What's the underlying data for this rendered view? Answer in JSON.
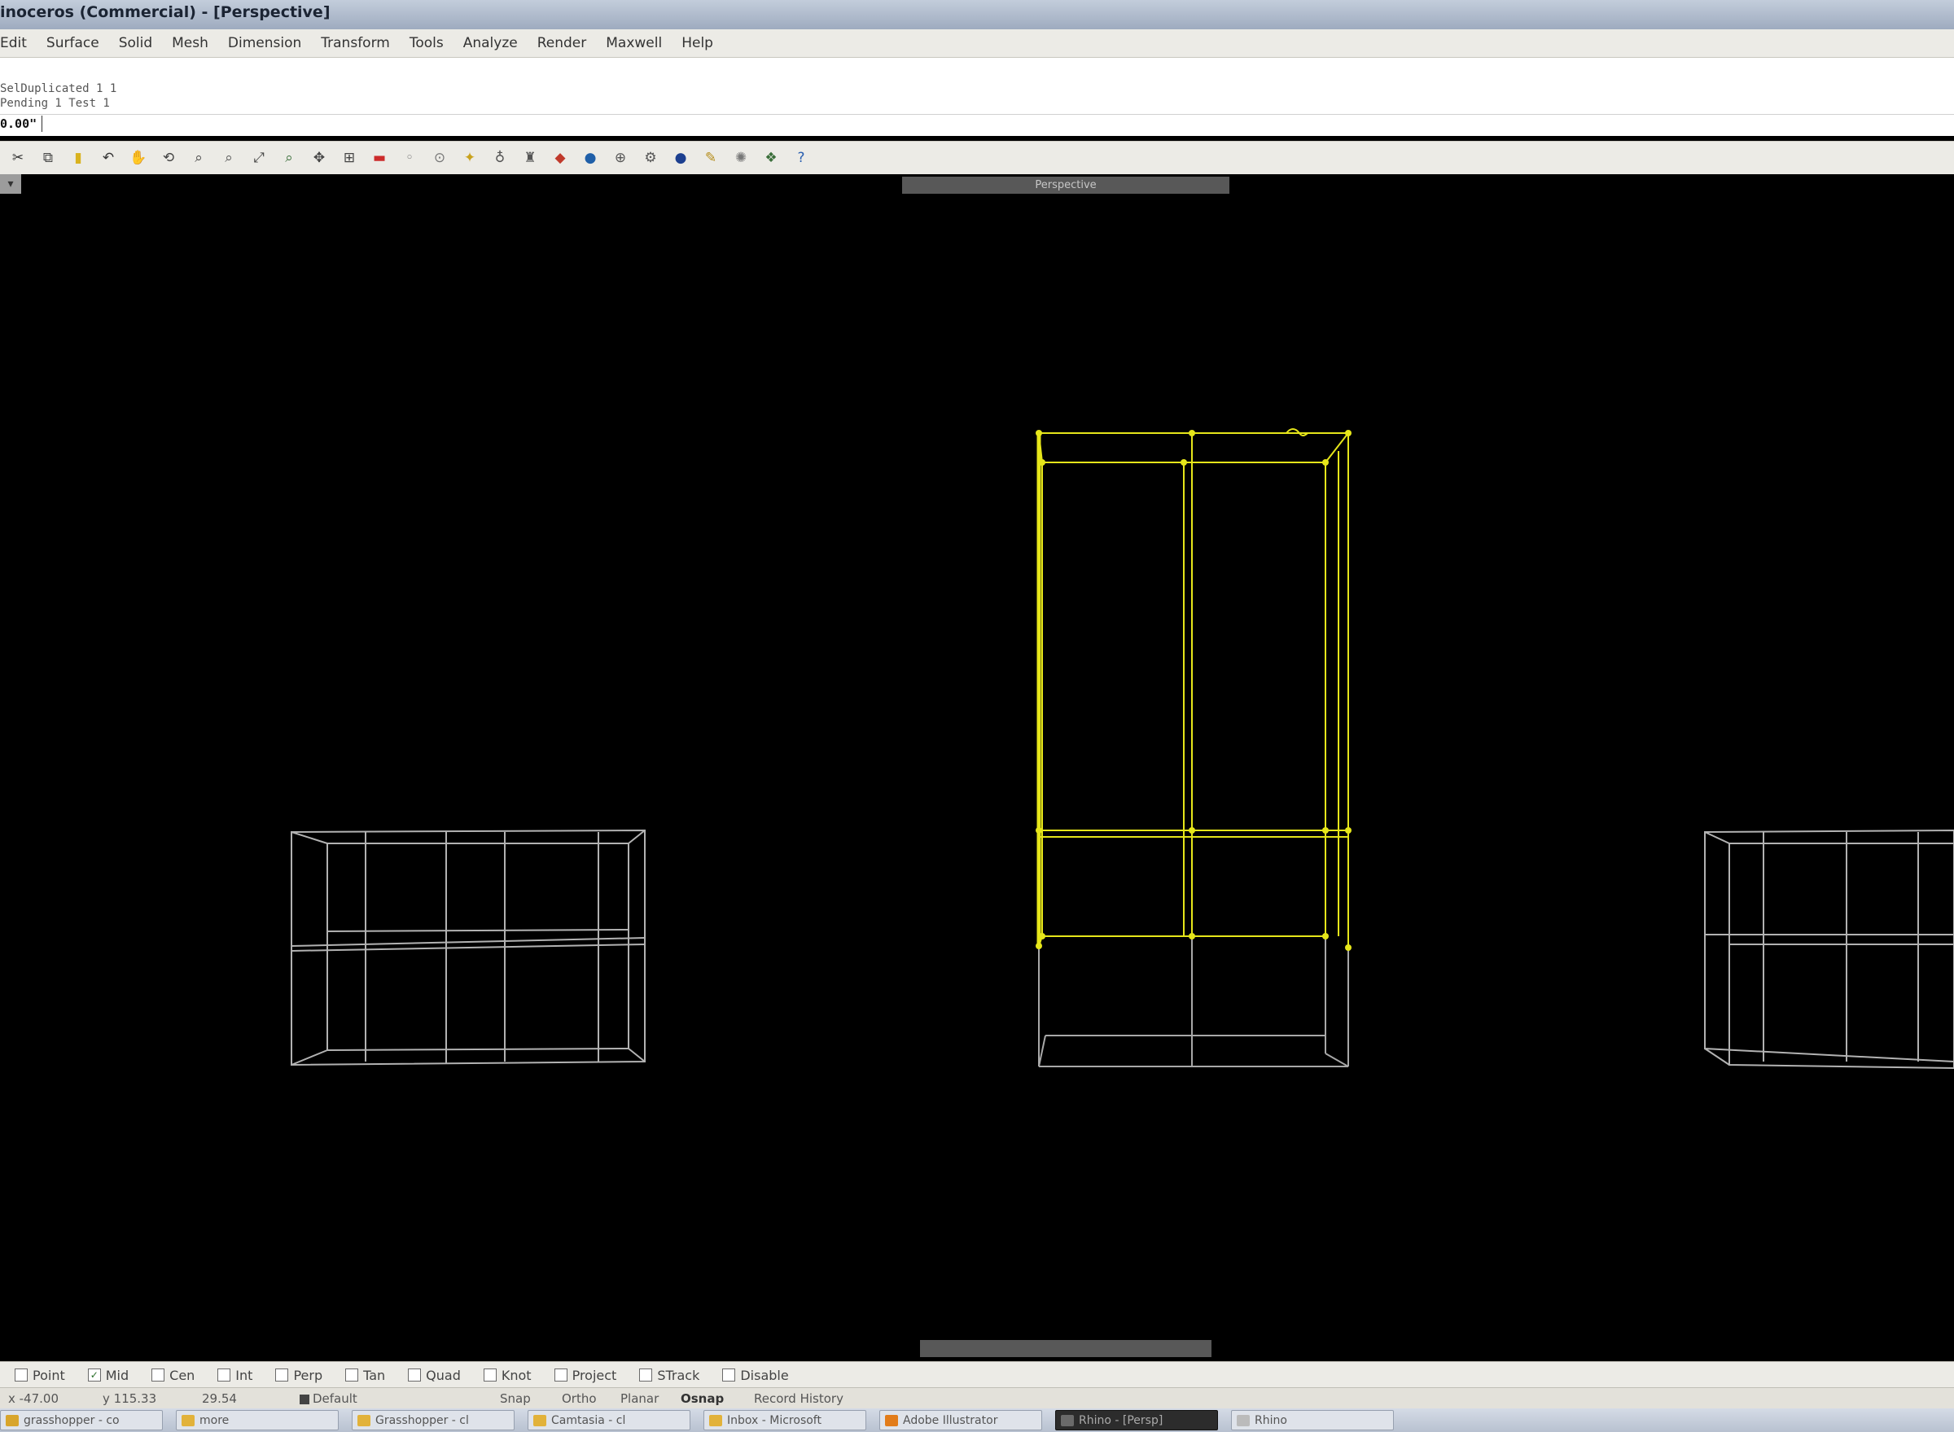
{
  "window": {
    "title": "inoceros (Commercial) - [Perspective]"
  },
  "menu": [
    "Edit",
    "Surface",
    "Solid",
    "Mesh",
    "Dimension",
    "Transform",
    "Tools",
    "Analyze",
    "Render",
    "Maxwell",
    "Help"
  ],
  "command": {
    "history": [
      "SelDuplicated 1 1",
      "Pending 1 Test 1"
    ],
    "prompt": "0.00\"",
    "input_value": ""
  },
  "toolbar": {
    "icons": [
      {
        "name": "cut-icon",
        "glyph": "✂",
        "color": "#333333"
      },
      {
        "name": "copy-icon",
        "glyph": "⧉",
        "color": "#444444"
      },
      {
        "name": "paste-icon",
        "glyph": "▮",
        "color": "#d9b21e"
      },
      {
        "name": "undo-icon",
        "glyph": "↶",
        "color": "#333333"
      },
      {
        "name": "pan-hand-icon",
        "glyph": "✋",
        "color": "#555555"
      },
      {
        "name": "rotate-view-icon",
        "glyph": "⟲",
        "color": "#444444"
      },
      {
        "name": "zoom-icon",
        "glyph": "⌕",
        "color": "#444444"
      },
      {
        "name": "zoom-window-icon",
        "glyph": "⌕",
        "color": "#555555"
      },
      {
        "name": "zoom-extents-icon",
        "glyph": "⤢",
        "color": "#444444"
      },
      {
        "name": "zoom-selected-icon",
        "glyph": "⌕",
        "color": "#3a6e3a"
      },
      {
        "name": "pan-view-icon",
        "glyph": "✥",
        "color": "#444444"
      },
      {
        "name": "grid-icon",
        "glyph": "⊞",
        "color": "#444444"
      },
      {
        "name": "layer-icon",
        "glyph": "▬",
        "color": "#cc2b2b"
      },
      {
        "name": "properties-icon",
        "glyph": "◦",
        "color": "#777777"
      },
      {
        "name": "select-icon",
        "glyph": "⊙",
        "color": "#777777"
      },
      {
        "name": "point-snap-icon",
        "glyph": "✦",
        "color": "#c9a21d"
      },
      {
        "name": "light-icon",
        "glyph": "♁",
        "color": "#555555"
      },
      {
        "name": "lock-icon",
        "glyph": "♜",
        "color": "#555555"
      },
      {
        "name": "material-icon",
        "glyph": "◆",
        "color": "#c0392b"
      },
      {
        "name": "render-sphere-icon",
        "glyph": "●",
        "color": "#1f5fa8"
      },
      {
        "name": "globe-icon",
        "glyph": "⊕",
        "color": "#555555"
      },
      {
        "name": "settings-icon",
        "glyph": "⚙",
        "color": "#555555"
      },
      {
        "name": "shaded-sphere-icon",
        "glyph": "●",
        "color": "#1c3f8f"
      },
      {
        "name": "script-icon",
        "glyph": "✎",
        "color": "#b58d1a"
      },
      {
        "name": "environment-icon",
        "glyph": "✺",
        "color": "#777777"
      },
      {
        "name": "plugin-icon",
        "glyph": "❖",
        "color": "#3a6e3a"
      },
      {
        "name": "help-icon",
        "glyph": "?",
        "color": "#2a5fb0"
      }
    ]
  },
  "viewport": {
    "name": "Perspective",
    "top_label": "Perspective",
    "bottom_label": "",
    "colors": {
      "background": "#000000",
      "selected": "#e6e61a",
      "wire": "#d2d2d2"
    }
  },
  "osnaps": [
    {
      "label": "Point",
      "checked": false
    },
    {
      "label": "Mid",
      "checked": true
    },
    {
      "label": "Cen",
      "checked": false
    },
    {
      "label": "Int",
      "checked": false
    },
    {
      "label": "Perp",
      "checked": false
    },
    {
      "label": "Tan",
      "checked": false
    },
    {
      "label": "Quad",
      "checked": false
    },
    {
      "label": "Knot",
      "checked": false
    },
    {
      "label": "Project",
      "checked": false
    },
    {
      "label": "STrack",
      "checked": false
    },
    {
      "label": "Disable",
      "checked": false
    }
  ],
  "status": {
    "x": "x -47.00",
    "y": "y 115.33",
    "z": "29.54",
    "layer": "Default",
    "modes": [
      "Snap",
      "Ortho",
      "Planar",
      "Osnap",
      "Record History"
    ],
    "active_mode": "Osnap"
  },
  "taskbar": [
    {
      "label": "grasshopper - co",
      "icon_color": "#d8a52c"
    },
    {
      "label": "more",
      "icon_color": "#e2b23a"
    },
    {
      "label": "Grasshopper - cl",
      "icon_color": "#e2b23a"
    },
    {
      "label": "Camtasia - cl",
      "icon_color": "#e2b23a"
    },
    {
      "label": "Inbox - Microsoft",
      "icon_color": "#e2b23a"
    },
    {
      "label": "Adobe Illustrator",
      "icon_color": "#e27c1a"
    },
    {
      "label": "Rhino - [Persp]",
      "icon_color": "#6a6a6a"
    },
    {
      "label": "Rhino",
      "icon_color": "#bbbbbb"
    }
  ],
  "taskbar_active_index": 6
}
